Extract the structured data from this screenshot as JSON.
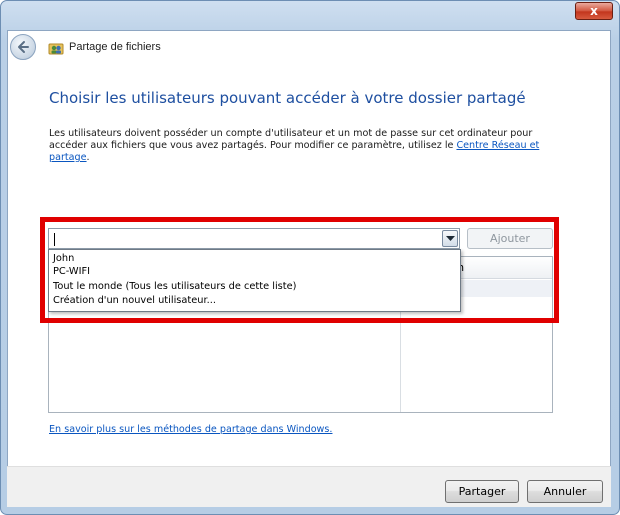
{
  "window": {
    "title": "Partage de fichiers",
    "close_label": "x"
  },
  "icons": {
    "back": "back-arrow-icon",
    "header": "users-share-icon",
    "combo_arrow": "chevron-down-icon"
  },
  "main": {
    "title": "Choisir les utilisateurs pouvant accéder à votre dossier partagé",
    "description_text": "Les utilisateurs doivent posséder un compte d'utilisateur et un mot de passe sur cet ordinateur pour accéder aux fichiers que vous avez partagés. Pour modifier ce paramètre, utilisez le ",
    "description_link": "Centre Réseau et partage",
    "description_end": "."
  },
  "user_picker": {
    "input_value": "",
    "add_button": "Ajouter",
    "dropdown_options": [
      "John",
      "PC-WIFI",
      "Tout le monde (Tous les utilisateurs de cette liste)",
      "Création d'un nouvel utilisateur..."
    ]
  },
  "table": {
    "permission_header_visible": "utorisation",
    "permission_cell_visible": "e ▼"
  },
  "learn_more_link": "En savoir plus sur les méthodes de partage dans Windows.",
  "footer": {
    "share_button": "Partager",
    "cancel_button": "Annuler"
  },
  "colors": {
    "highlight": "#e00000",
    "title_blue": "#1e4fa0",
    "link_blue": "#0a56c0"
  }
}
